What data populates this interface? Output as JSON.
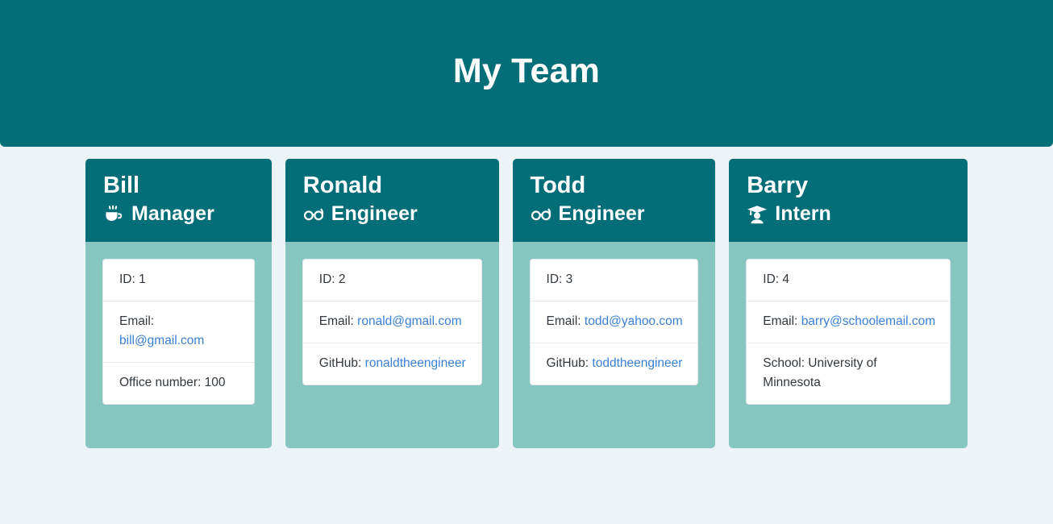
{
  "header": {
    "title": "My Team"
  },
  "theme": {
    "page_background": "#edf4f7",
    "header_background": "#046e78",
    "card_body_background": "#87c6c0",
    "card_header_background": "#046e78",
    "link_color": "#3a80d4",
    "panel_background": "#ffffff"
  },
  "members": [
    {
      "name": "Bill",
      "role": "Manager",
      "role_icon": "coffee-cup-icon",
      "fields": [
        {
          "label": "ID: 1",
          "value": "",
          "link": ""
        },
        {
          "label": "Email:",
          "value": "",
          "link": "bill@gmail.com"
        },
        {
          "label": "Office number: 100",
          "value": "",
          "link": ""
        }
      ]
    },
    {
      "name": "Ronald",
      "role": "Engineer",
      "role_icon": "glasses-icon",
      "fields": [
        {
          "label": "ID: 2",
          "value": "",
          "link": ""
        },
        {
          "label": "Email:",
          "value": "",
          "link": "ronald@gmail.com"
        },
        {
          "label": "GitHub:",
          "value": "",
          "link": "ronaldtheengineer"
        }
      ]
    },
    {
      "name": "Todd",
      "role": "Engineer",
      "role_icon": "glasses-icon",
      "fields": [
        {
          "label": "ID: 3",
          "value": "",
          "link": ""
        },
        {
          "label": "Email:",
          "value": "",
          "link": "todd@yahoo.com"
        },
        {
          "label": "GitHub:",
          "value": "",
          "link": "toddtheengineer"
        }
      ]
    },
    {
      "name": "Barry",
      "role": "Intern",
      "role_icon": "graduate-student-icon",
      "fields": [
        {
          "label": "ID: 4",
          "value": "",
          "link": ""
        },
        {
          "label": "Email:",
          "value": "",
          "link": "barry@schoolemail.com"
        },
        {
          "label": "School: University of Minnesota",
          "value": "",
          "link": ""
        }
      ]
    }
  ]
}
